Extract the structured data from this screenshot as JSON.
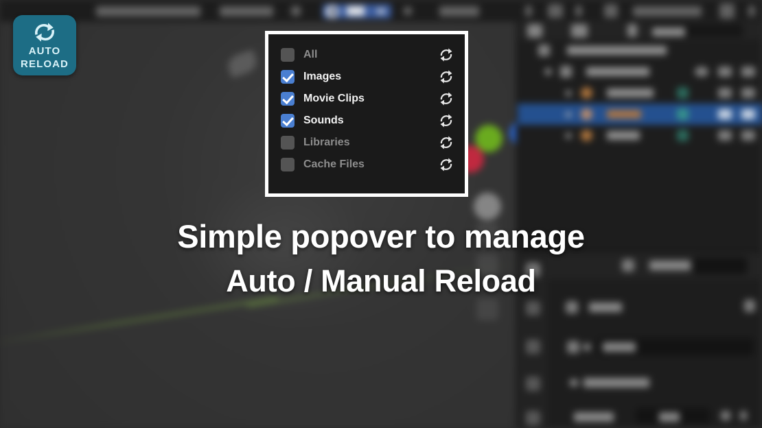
{
  "badge": {
    "icon": "auto-reload-icon",
    "line1": "AUTO",
    "line2": "RELOAD",
    "color": "#1d6d85"
  },
  "headline": {
    "line1": "Simple popover to manage",
    "line2": "Auto / Manual Reload"
  },
  "popover": {
    "border_color": "#ffffff",
    "background": "#1a1a1a",
    "checked_color": "#4a7fd1",
    "unchecked_color": "#545454",
    "rows": [
      {
        "label": "All",
        "checked": false,
        "reload_icon": "reload-icon"
      },
      {
        "label": "Images",
        "checked": true,
        "reload_icon": "reload-icon"
      },
      {
        "label": "Movie Clips",
        "checked": true,
        "reload_icon": "reload-icon"
      },
      {
        "label": "Sounds",
        "checked": true,
        "reload_icon": "reload-icon"
      },
      {
        "label": "Libraries",
        "checked": false,
        "reload_icon": "reload-icon"
      },
      {
        "label": "Cache Files",
        "checked": false,
        "reload_icon": "reload-icon"
      }
    ]
  },
  "topbar": {
    "dropdown": {
      "label": "AR",
      "icon": "ar-circle-icon",
      "chevron": "chevron-down-icon",
      "highlight_color": "#3b5c9e"
    }
  }
}
